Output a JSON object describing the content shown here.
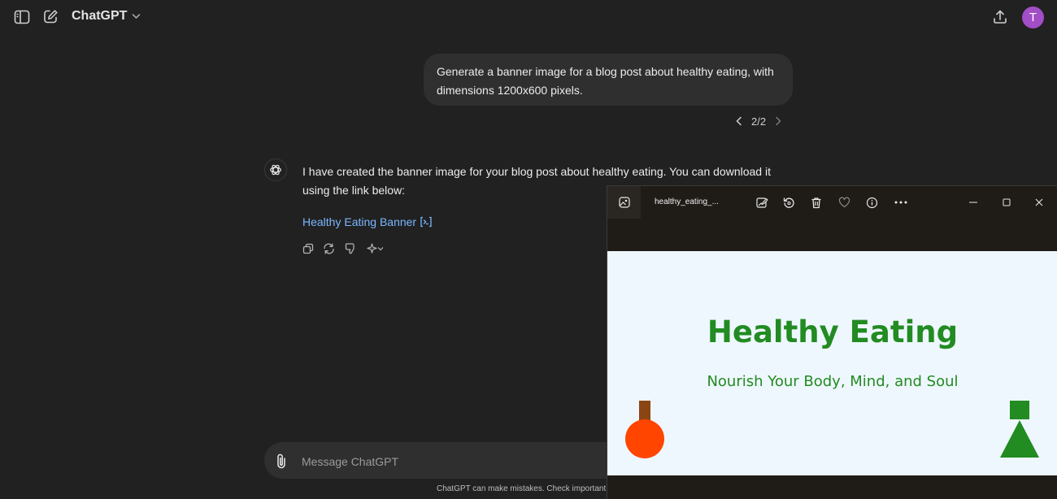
{
  "header": {
    "title": "ChatGPT",
    "avatar_letter": "T"
  },
  "conversation": {
    "user_message": "Generate a banner image for a blog post about healthy eating, with dimensions 1200x600 pixels.",
    "pager": "2/2",
    "assistant_message": "I have created the banner image for your blog post about healthy eating. You can download it using the link below:",
    "link_text": "Healthy Eating Banner"
  },
  "composer": {
    "placeholder": "Message ChatGPT",
    "disclaimer": "ChatGPT can make mistakes. Check important i"
  },
  "viewer": {
    "file_name": "healthy_eating_...",
    "banner_title": "Healthy Eating",
    "banner_subtitle": "Nourish Your Body, Mind, and Soul"
  },
  "colors": {
    "background": "#212121",
    "bubble": "#2f2f2f",
    "link": "#7ab7ff",
    "avatar": "#a24ec6",
    "banner_bg": "#eef7fd",
    "banner_green": "#228b22",
    "apple_red": "#ff4500",
    "stem_brown": "#8b4513"
  }
}
